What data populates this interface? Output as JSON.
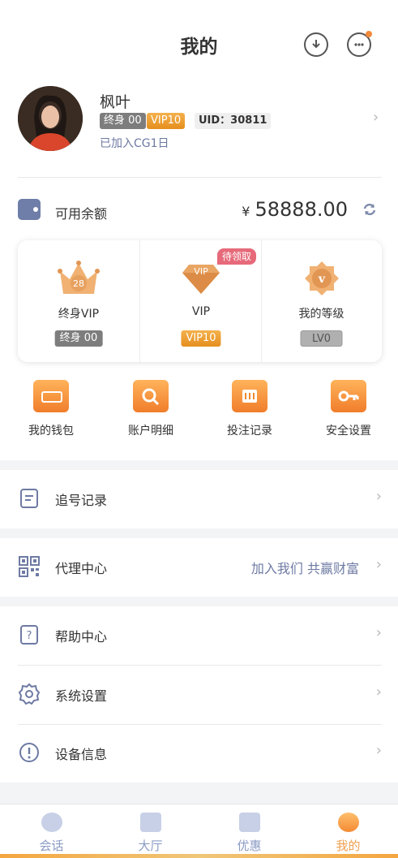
{
  "header": {
    "title": "我的"
  },
  "profile": {
    "name": "枫叶",
    "badge_lifetime": "终身 00",
    "badge_vip": "VIP10",
    "uid": "UID：30811",
    "joined": "已加入CG1日"
  },
  "balance": {
    "label": "可用余额",
    "currency": "¥",
    "amount": "58888.00"
  },
  "vip_card": {
    "pending_tag": "待领取",
    "items": [
      {
        "label": "终身VIP",
        "badge": "终身 00",
        "icon_text": "28"
      },
      {
        "label": "VIP",
        "badge": "VIP10",
        "icon_text": "VIP"
      },
      {
        "label": "我的等级",
        "badge": "LV0",
        "icon_text": "v"
      }
    ]
  },
  "quick_actions": [
    {
      "label": "我的钱包",
      "icon": "wallet-icon"
    },
    {
      "label": "账户明细",
      "icon": "search-detail-icon"
    },
    {
      "label": "投注记录",
      "icon": "betting-record-icon"
    },
    {
      "label": "安全设置",
      "icon": "key-icon"
    }
  ],
  "menu": {
    "follow_record": "追号记录",
    "agent_center": "代理中心",
    "agent_extra": "加入我们 共赢财富",
    "help_center": "帮助中心",
    "system_settings": "系统设置",
    "device_info": "设备信息"
  },
  "tabbar": {
    "tabs": [
      {
        "label": "会话",
        "icon": "chat-icon"
      },
      {
        "label": "大厅",
        "icon": "bank-icon"
      },
      {
        "label": "优惠",
        "icon": "coupon-icon"
      },
      {
        "label": "我的",
        "icon": "user-icon"
      }
    ],
    "active_index": 3
  },
  "colors": {
    "accent": "#f08a2e",
    "link": "#6e7aa3",
    "vip_gold": "#e8951f"
  }
}
